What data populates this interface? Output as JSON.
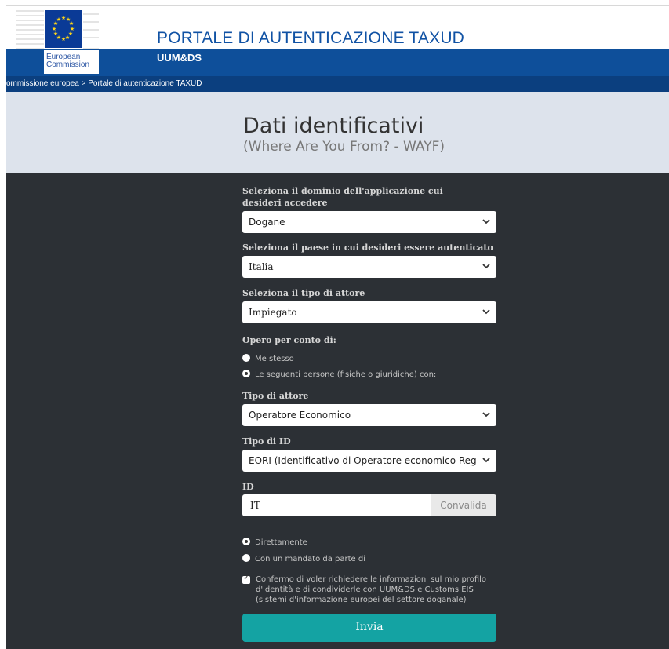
{
  "header": {
    "logo_text_line1": "European",
    "logo_text_line2": "Commission",
    "title": "PORTALE DI AUTENTICAZIONE TAXUD",
    "subtitle": "UUM&DS"
  },
  "breadcrumb": {
    "item1": "ommissione europea",
    "separator": ">",
    "item2": "Portale di autenticazione TAXUD"
  },
  "hero": {
    "title": "Dati identificativi",
    "subtitle": "(Where Are You From? - WAYF)"
  },
  "form": {
    "domain_label": "Seleziona il dominio dell'applicazione cui desideri accedere",
    "domain_value": "Dogane",
    "country_label": "Seleziona il paese in cui desideri essere autenticato",
    "country_value": "Italia",
    "actor_type_label": "Seleziona il tipo di attore",
    "actor_type_value": "Impiegato",
    "on_behalf_label": "Opero per conto di:",
    "on_behalf_options": [
      {
        "label": "Me stesso",
        "checked": false
      },
      {
        "label": "Le seguenti persone (fisiche o giuridiche) con:",
        "checked": true
      }
    ],
    "rep_actor_label": "Tipo di attore",
    "rep_actor_value": "Operatore Economico",
    "id_type_label": "Tipo di ID",
    "id_type_value": "EORI (Identificativo di Operatore economico Reg",
    "id_label": "ID",
    "id_value": "IT",
    "validate_label": "Convalida",
    "mode_options": [
      {
        "label": "Direttamente",
        "checked": true
      },
      {
        "label": "Con un mandato da parte di",
        "checked": false
      }
    ],
    "confirm_checked": true,
    "confirm_text": "Confermo di voler richiedere le informazioni sul mio profilo d'identità e di condividerle con UUM&DS e Customs EIS (sistemi d'informazione europei del settore doganale)",
    "submit_label": "Invia"
  },
  "icons": {
    "logo": "eu-flag-logo",
    "select_arrow": "chevron-down-icon"
  },
  "colors": {
    "brand_blue": "#0e4f9a",
    "breadcrumb_blue": "#0b3f7f",
    "hero_bg": "#dde3ec",
    "form_bg": "#2c3035",
    "submit": "#14a3a3"
  }
}
